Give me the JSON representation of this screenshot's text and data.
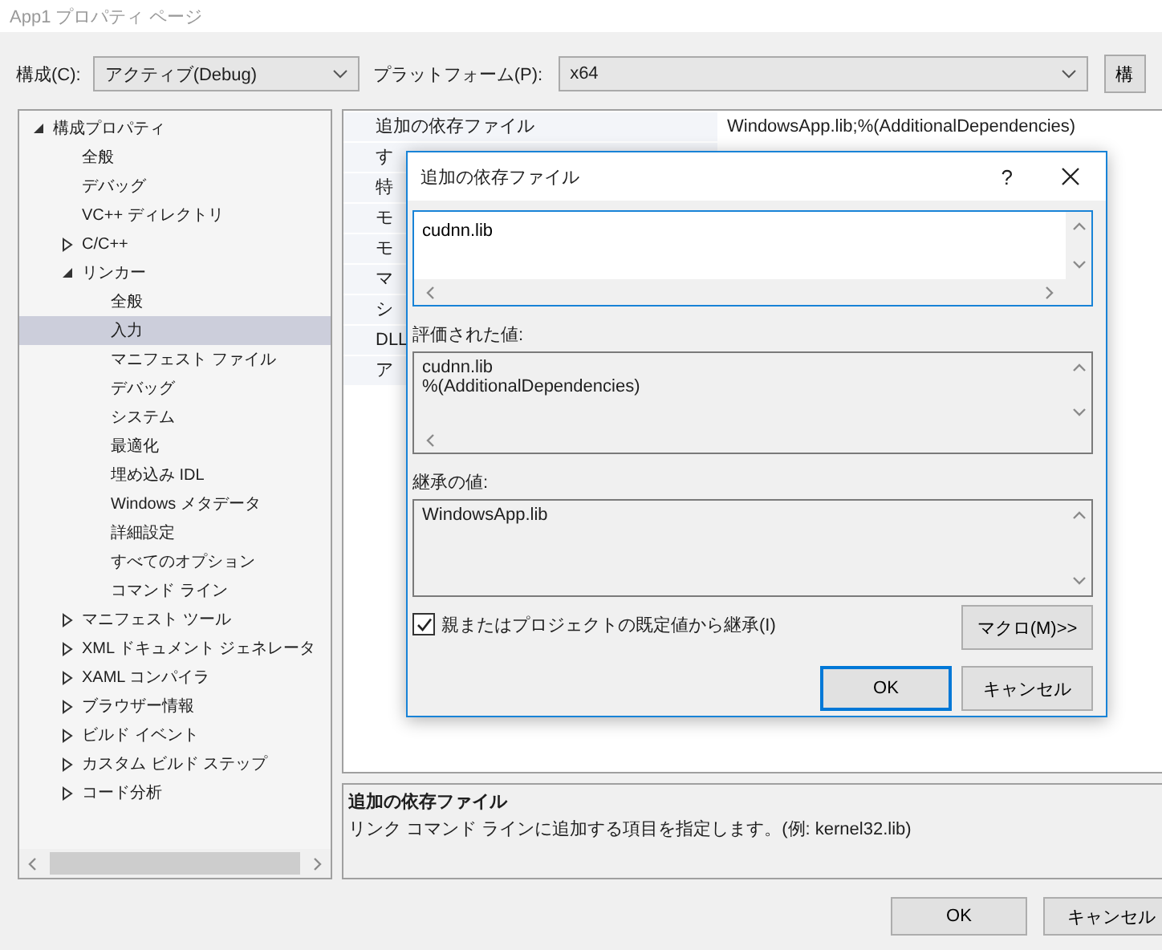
{
  "window": {
    "title": "App1 プロパティ ページ"
  },
  "toolbar": {
    "configuration_label": "構成(C):",
    "configuration": "アクティブ(Debug)",
    "platform_label": "プラットフォーム(P):",
    "platform": "x64",
    "manager_button": "構"
  },
  "tree": [
    {
      "label": "構成プロパティ",
      "expanded": true,
      "selected": false,
      "children": [
        {
          "label": "全般",
          "selected": false
        },
        {
          "label": "デバッグ",
          "selected": false
        },
        {
          "label": "VC++ ディレクトリ",
          "selected": false
        },
        {
          "label": "C/C++",
          "expanded": false,
          "selected": false
        },
        {
          "label": "リンカー",
          "expanded": true,
          "selected": false,
          "children": [
            {
              "label": "全般",
              "selected": false
            },
            {
              "label": "入力",
              "selected": true
            },
            {
              "label": "マニフェスト ファイル",
              "selected": false
            },
            {
              "label": "デバッグ",
              "selected": false
            },
            {
              "label": "システム",
              "selected": false
            },
            {
              "label": "最適化",
              "selected": false
            },
            {
              "label": "埋め込み IDL",
              "selected": false
            },
            {
              "label": "Windows メタデータ",
              "selected": false
            },
            {
              "label": "詳細設定",
              "selected": false
            },
            {
              "label": "すべてのオプション",
              "selected": false
            },
            {
              "label": "コマンド ライン",
              "selected": false
            }
          ]
        },
        {
          "label": "マニフェスト ツール",
          "expanded": false,
          "selected": false
        },
        {
          "label": "XML ドキュメント ジェネレータ",
          "expanded": false,
          "selected": false
        },
        {
          "label": "XAML コンパイラ",
          "expanded": false,
          "selected": false
        },
        {
          "label": "ブラウザー情報",
          "expanded": false,
          "selected": false
        },
        {
          "label": "ビルド イベント",
          "expanded": false,
          "selected": false
        },
        {
          "label": "カスタム ビルド ステップ",
          "expanded": false,
          "selected": false
        },
        {
          "label": "コード分析",
          "expanded": false,
          "selected": false
        }
      ]
    }
  ],
  "grid": {
    "rows": [
      {
        "name": "追加の依存ファイル",
        "value": "WindowsApp.lib;%(AdditionalDependencies)"
      },
      {
        "name": "す"
      },
      {
        "name": "特"
      },
      {
        "name": "モ"
      },
      {
        "name": "モ"
      },
      {
        "name": "マ"
      },
      {
        "name": "シ"
      },
      {
        "name": "DLL"
      },
      {
        "name": "ア"
      }
    ]
  },
  "description": {
    "title": "追加の依存ファイル",
    "text": "リンク コマンド ラインに追加する項目を指定します。(例: kernel32.lib)"
  },
  "buttons": [
    "OK",
    "キャンセル"
  ],
  "dialog": {
    "title": "追加の依存ファイル",
    "help": "?",
    "value": "cudnn.lib",
    "evaluated_label": "評価された値:",
    "evaluated_lines": [
      "cudnn.lib",
      "%(AdditionalDependencies)"
    ],
    "inherited_label": "継承の値:",
    "inherited_lines": [
      "WindowsApp.lib"
    ],
    "inherit_checkbox": {
      "label": "親またはプロジェクトの既定値から継承(I)",
      "checked": true
    },
    "macro_button": "マクロ(M)>>",
    "buttons": [
      {
        "label": "OK",
        "default": true
      },
      {
        "label": "キャンセル",
        "default": false
      }
    ]
  }
}
